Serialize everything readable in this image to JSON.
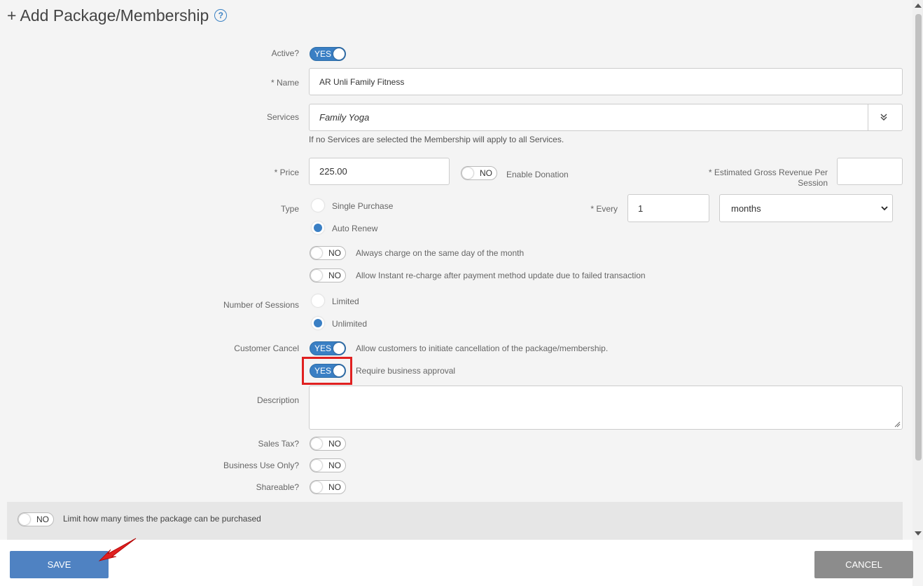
{
  "title": "+ Add Package/Membership",
  "icons": {
    "help": "help-circle-icon",
    "chevrons": "double-chevron-down-icon",
    "select_arrow": "chevron-down-icon",
    "resize": "resize-handle-icon"
  },
  "colors": {
    "accent": "#3a7fc4",
    "highlight": "#e02020",
    "cancel": "#8c8c8c"
  },
  "fields": {
    "active": {
      "label": "Active?",
      "state": "YES"
    },
    "name": {
      "label": "* Name",
      "value": "AR Unli Family Fitness"
    },
    "services": {
      "label": "Services",
      "value": "Family Yoga",
      "help": "If no Services are selected the Membership will apply to all Services."
    },
    "price": {
      "label": "* Price",
      "value": "225.00"
    },
    "donation": {
      "state": "NO",
      "label": "Enable Donation"
    },
    "revenue": {
      "label": "* Estimated Gross Revenue Per Session",
      "value": ""
    },
    "type": {
      "label": "Type",
      "options": [
        "Single Purchase",
        "Auto Renew"
      ],
      "selected": "Auto Renew"
    },
    "every": {
      "label": "* Every",
      "value": "1",
      "unit": "months"
    },
    "same_day": {
      "state": "NO",
      "label": "Always charge on the same day of the month"
    },
    "instant_recharge": {
      "state": "NO",
      "label": "Allow Instant re-charge after payment method update due to failed transaction"
    },
    "sessions": {
      "label": "Number of Sessions",
      "options": [
        "Limited",
        "Unlimited"
      ],
      "selected": "Unlimited"
    },
    "customer_cancel": {
      "label": "Customer Cancel",
      "state": "YES",
      "text": "Allow customers to initiate cancellation of the package/membership."
    },
    "approval": {
      "state": "YES",
      "text": "Require business approval"
    },
    "description": {
      "label": "Description",
      "value": ""
    },
    "sales_tax": {
      "label": "Sales Tax?",
      "state": "NO"
    },
    "business_use": {
      "label": "Business Use Only?",
      "state": "NO"
    },
    "shareable": {
      "label": "Shareable?",
      "state": "NO"
    },
    "limit": {
      "state": "NO",
      "label": "Limit how many times the package can be purchased"
    }
  },
  "footer": {
    "save": "SAVE",
    "cancel": "CANCEL"
  }
}
